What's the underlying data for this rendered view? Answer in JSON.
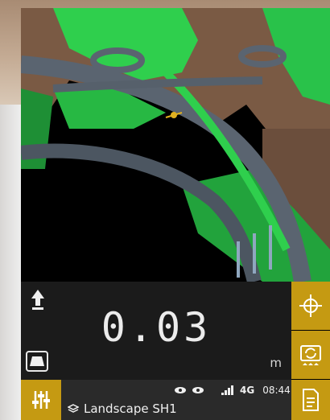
{
  "readout": {
    "value": "0.03",
    "unit": "m"
  },
  "status_bar": {
    "layer_name": "Landscape SH1",
    "network": "4G",
    "time": "08:44"
  },
  "icons": {
    "north_arrow": "up-arrow-icon",
    "view_mode": "trapezoid-view-icon",
    "target": "crosshair-icon",
    "swap": "camera-swap-icon",
    "document": "document-icon",
    "settings": "sliders-icon",
    "layers": "layers-icon",
    "visibility": "eye-icon",
    "signal": "signal-bars-icon"
  },
  "colors": {
    "accent": "#c59a12",
    "panel": "#1b1b1b",
    "terrain_green": "#29c24a",
    "road_gray": "#5a6470"
  }
}
